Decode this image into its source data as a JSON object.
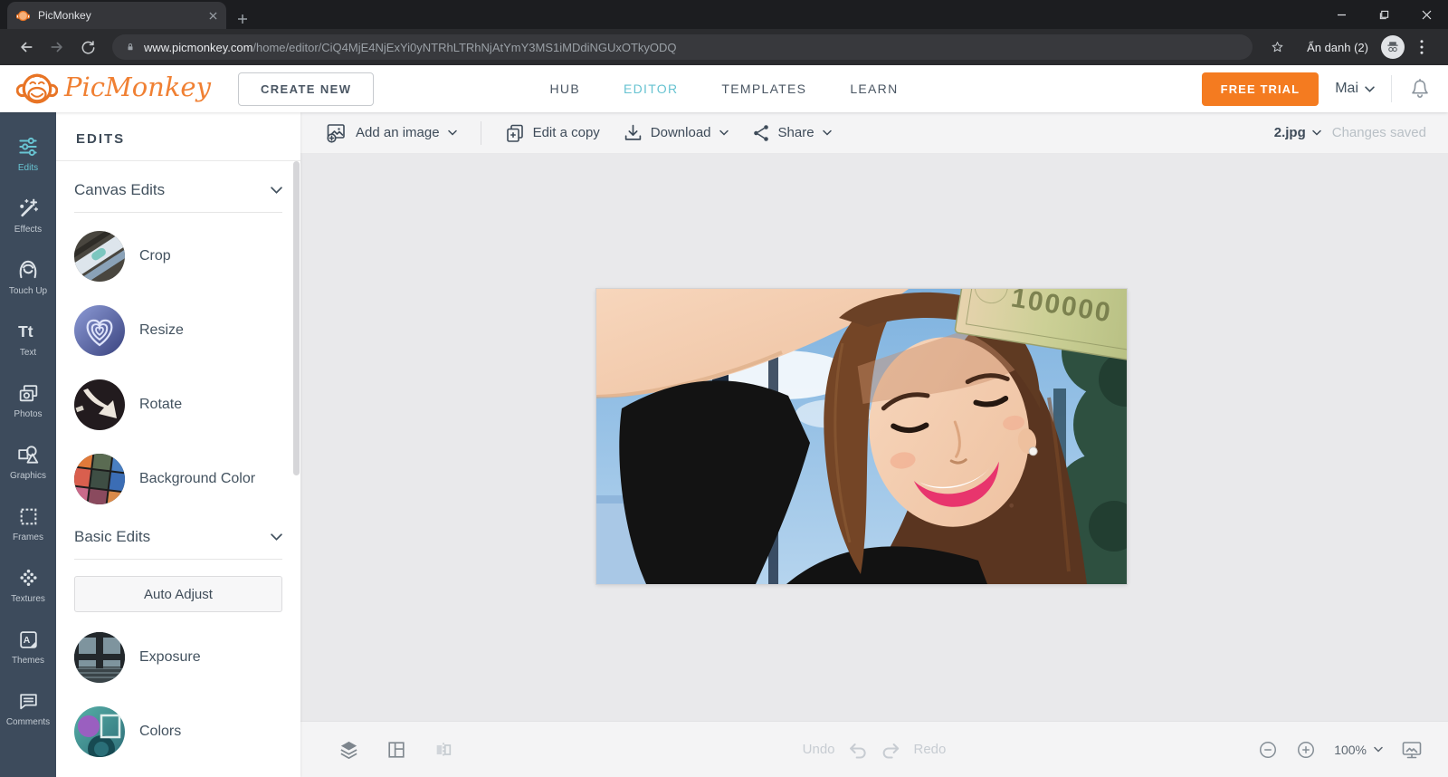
{
  "browser": {
    "tab_title": "PicMonkey",
    "url_domain": "www.picmonkey.com",
    "url_path": "/home/editor/CiQ4MjE4NjExYi0yNTRhLTRhNjAtYmY3MS1iMDdiNGUxOTkyODQ",
    "incognito_label": "Ẩn danh (2)"
  },
  "header": {
    "logo_text": "PicMonkey",
    "create_new_label": "CREATE NEW",
    "nav": [
      {
        "label": "HUB",
        "active": false
      },
      {
        "label": "EDITOR",
        "active": true
      },
      {
        "label": "TEMPLATES",
        "active": false
      },
      {
        "label": "LEARN",
        "active": false
      }
    ],
    "free_trial_label": "FREE TRIAL",
    "user_name": "Mai"
  },
  "sidebar": {
    "active_item": "Edits",
    "items": [
      {
        "label": "Edits",
        "icon": "sliders-icon"
      },
      {
        "label": "Effects",
        "icon": "magic-wand-icon"
      },
      {
        "label": "Touch Up",
        "icon": "face-icon"
      },
      {
        "label": "Text",
        "icon": "text-icon",
        "glyph": "Tt"
      },
      {
        "label": "Photos",
        "icon": "photos-icon"
      },
      {
        "label": "Graphics",
        "icon": "shapes-icon"
      },
      {
        "label": "Frames",
        "icon": "frame-icon"
      },
      {
        "label": "Textures",
        "icon": "texture-icon"
      },
      {
        "label": "Themes",
        "icon": "themes-icon",
        "glyph": "A"
      },
      {
        "label": "Comments",
        "icon": "comment-icon"
      }
    ]
  },
  "panel": {
    "title": "EDITS",
    "canvas_edits_label": "Canvas Edits",
    "canvas_edits_items": [
      {
        "label": "Crop"
      },
      {
        "label": "Resize"
      },
      {
        "label": "Rotate"
      },
      {
        "label": "Background Color"
      }
    ],
    "basic_edits_label": "Basic Edits",
    "auto_adjust_label": "Auto Adjust",
    "basic_edits_items": [
      {
        "label": "Exposure"
      },
      {
        "label": "Colors"
      }
    ]
  },
  "toolbar": {
    "add_image_label": "Add an image",
    "edit_copy_label": "Edit a copy",
    "download_label": "Download",
    "share_label": "Share",
    "file_name": "2.jpg",
    "status": "Changes saved"
  },
  "canvas": {
    "photo_alt": "Smiling woman with wavy brown hair balancing a banknote on her head, blue sky and foliage behind",
    "note_text": "100000"
  },
  "bottombar": {
    "undo_label": "Undo",
    "redo_label": "Redo",
    "zoom_level": "100%"
  },
  "colors": {
    "accent_orange": "#f47b20",
    "accent_teal": "#67c3d1",
    "sidebar_bg": "#3d4b5c"
  }
}
